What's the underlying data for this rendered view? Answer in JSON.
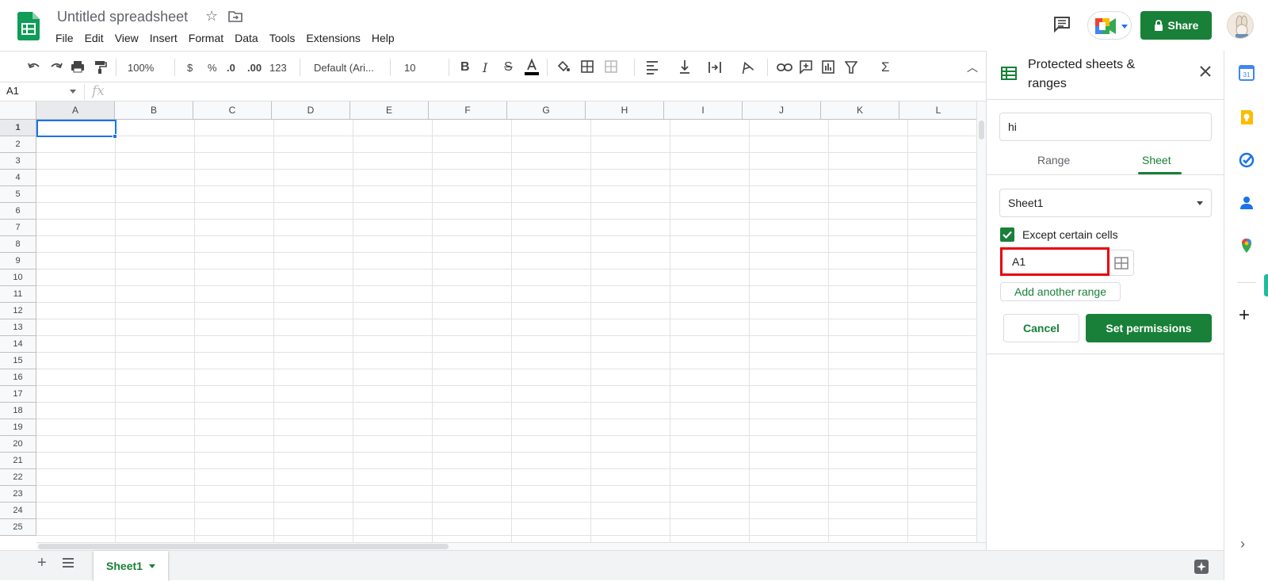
{
  "header": {
    "title": "Untitled spreadsheet",
    "menu": [
      "File",
      "Edit",
      "View",
      "Insert",
      "Format",
      "Data",
      "Tools",
      "Extensions",
      "Help"
    ],
    "share_label": "Share"
  },
  "toolbar": {
    "zoom": "100%",
    "currency": "$",
    "percent": "%",
    "decrease_decimal": ".0",
    "increase_decimal": ".00",
    "more_formats": "123",
    "font": "Default (Ari...",
    "font_size": "10"
  },
  "formula_bar": {
    "cell_ref": "A1",
    "fx": "fx"
  },
  "grid": {
    "columns": [
      "A",
      "B",
      "C",
      "D",
      "E",
      "F",
      "G",
      "H",
      "I",
      "J",
      "K",
      "L"
    ],
    "rows": [
      "1",
      "2",
      "3",
      "4",
      "5",
      "6",
      "7",
      "8",
      "9",
      "10",
      "11",
      "12",
      "13",
      "14",
      "15",
      "16",
      "17",
      "18",
      "19",
      "20",
      "21",
      "22",
      "23",
      "24",
      "25"
    ],
    "selected_cell": "A1"
  },
  "sheets": {
    "active_tab": "Sheet1"
  },
  "panel": {
    "title": "Protected sheets & ranges",
    "description_value": "hi",
    "tabs": [
      "Range",
      "Sheet"
    ],
    "active_tab": "Sheet",
    "sheet_select": "Sheet1",
    "except_label": "Except certain cells",
    "except_checked": true,
    "range_value": "A1",
    "add_range_label": "Add another range",
    "cancel_label": "Cancel",
    "set_permissions_label": "Set permissions"
  },
  "rail": {
    "icons": [
      "calendar-icon",
      "keep-icon",
      "tasks-icon",
      "contacts-icon",
      "maps-icon"
    ],
    "calendar_day": "31"
  },
  "colors": {
    "brand_green": "#188038",
    "selection_blue": "#1a73e8",
    "highlight_red": "#e8000b"
  }
}
